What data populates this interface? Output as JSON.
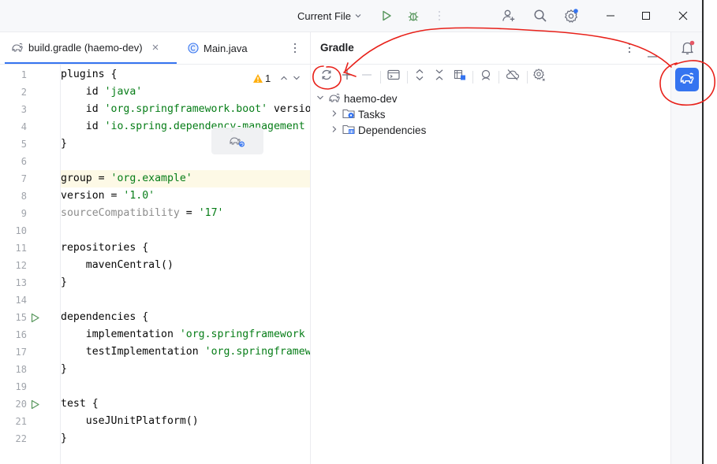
{
  "titlebar": {
    "run_config": "Current File",
    "colors": {
      "run": "#57965c",
      "debug": "#57965c",
      "badge": "#3574f0"
    }
  },
  "editor": {
    "tabs": [
      {
        "label": "build.gradle (haemo-dev)",
        "icon": "gradle-elephant-icon",
        "active": true
      },
      {
        "label": "Main.java",
        "icon": "class-c-icon",
        "active": false
      }
    ],
    "inspection": {
      "count": "1"
    },
    "line_numbers": [
      "1",
      "2",
      "3",
      "4",
      "5",
      "6",
      "7",
      "8",
      "9",
      "10",
      "11",
      "12",
      "13",
      "14",
      "15",
      "16",
      "17",
      "18",
      "19",
      "20",
      "21",
      "22"
    ],
    "lines": [
      {
        "parts": [
          {
            "t": "plugins {",
            "c": ""
          }
        ]
      },
      {
        "parts": [
          {
            "t": "    id ",
            "c": ""
          },
          {
            "t": "'java'",
            "c": "str"
          }
        ]
      },
      {
        "parts": [
          {
            "t": "    id ",
            "c": ""
          },
          {
            "t": "'org.springframework.boot'",
            "c": "str"
          },
          {
            "t": " version",
            "c": ""
          }
        ]
      },
      {
        "parts": [
          {
            "t": "    id ",
            "c": ""
          },
          {
            "t": "'io.spring.dependency-management",
            "c": "str"
          }
        ]
      },
      {
        "parts": [
          {
            "t": "}",
            "c": ""
          }
        ]
      },
      {
        "parts": [
          {
            "t": "",
            "c": ""
          }
        ]
      },
      {
        "parts": [
          {
            "t": "group = ",
            "c": ""
          },
          {
            "t": "'org.example'",
            "c": "str"
          }
        ],
        "hl": true
      },
      {
        "parts": [
          {
            "t": "version = ",
            "c": ""
          },
          {
            "t": "'1.0'",
            "c": "str"
          }
        ]
      },
      {
        "parts": [
          {
            "t": "sourceCompatibility",
            "c": "dim"
          },
          {
            "t": " = ",
            "c": ""
          },
          {
            "t": "'17'",
            "c": "str"
          }
        ]
      },
      {
        "parts": [
          {
            "t": "",
            "c": ""
          }
        ]
      },
      {
        "parts": [
          {
            "t": "repositories {",
            "c": ""
          }
        ]
      },
      {
        "parts": [
          {
            "t": "    mavenCentral()",
            "c": ""
          }
        ]
      },
      {
        "parts": [
          {
            "t": "}",
            "c": ""
          }
        ]
      },
      {
        "parts": [
          {
            "t": "",
            "c": ""
          }
        ]
      },
      {
        "parts": [
          {
            "t": "dependencies {",
            "c": ""
          }
        ],
        "run": true
      },
      {
        "parts": [
          {
            "t": "    implementation ",
            "c": ""
          },
          {
            "t": "'org.springframework",
            "c": "str"
          }
        ]
      },
      {
        "parts": [
          {
            "t": "    testImplementation ",
            "c": ""
          },
          {
            "t": "'org.springframew",
            "c": "str"
          }
        ]
      },
      {
        "parts": [
          {
            "t": "}",
            "c": ""
          }
        ]
      },
      {
        "parts": [
          {
            "t": "",
            "c": ""
          }
        ]
      },
      {
        "parts": [
          {
            "t": "test {",
            "c": ""
          }
        ],
        "run": true
      },
      {
        "parts": [
          {
            "t": "    useJUnitPlatform()",
            "c": ""
          }
        ]
      },
      {
        "parts": [
          {
            "t": "}",
            "c": ""
          }
        ]
      }
    ]
  },
  "gradle": {
    "title": "Gradle",
    "tree": [
      {
        "label": "haemo-dev",
        "icon": "gradle-elephant-icon",
        "expanded": true,
        "level": 0
      },
      {
        "label": "Tasks",
        "icon": "folder-gear-icon",
        "expanded": false,
        "level": 1
      },
      {
        "label": "Dependencies",
        "icon": "folder-library-icon",
        "expanded": false,
        "level": 1
      }
    ]
  },
  "colors": {
    "accent": "#3574f0",
    "annotation": "#e8211a",
    "string": "#067d17"
  }
}
